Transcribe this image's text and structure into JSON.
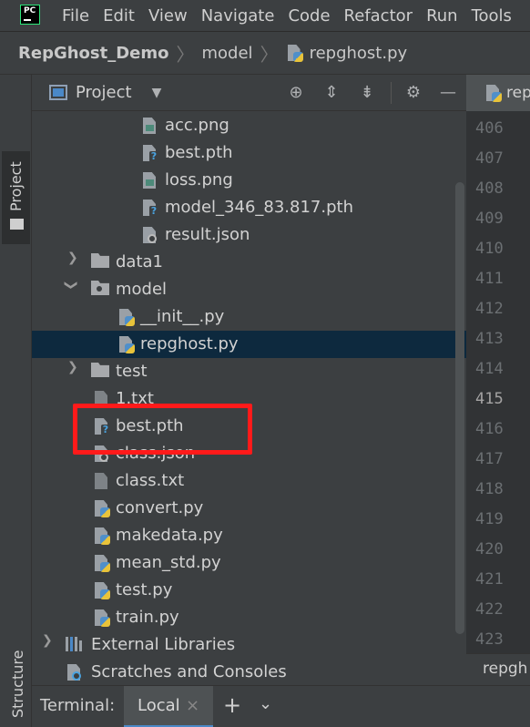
{
  "menu": {
    "app_icon_text": "PC",
    "items": [
      "File",
      "Edit",
      "View",
      "Navigate",
      "Code",
      "Refactor",
      "Run",
      "Tools"
    ]
  },
  "breadcrumb": {
    "root": "RepGhost_Demo",
    "folder": "model",
    "file": "repghost.py"
  },
  "left_strip": {
    "project_tab": "Project",
    "structure_tab": "Structure"
  },
  "project_panel": {
    "title": "Project",
    "dropdown_icon": "caret-down-icon",
    "header_icons": [
      "locate-icon",
      "expand-all-icon",
      "collapse-all-icon",
      "gear-icon",
      "minimize-icon"
    ]
  },
  "tree": {
    "rows": [
      {
        "label": "acc.png",
        "icon": "image-file-icon"
      },
      {
        "label": "best.pth",
        "icon": "unknown-file-icon"
      },
      {
        "label": "loss.png",
        "icon": "image-file-icon"
      },
      {
        "label": "model_346_83.817.pth",
        "icon": "unknown-file-icon"
      },
      {
        "label": "result.json",
        "icon": "json-file-icon"
      },
      {
        "label": "data1",
        "icon": "folder-icon",
        "expanded": false
      },
      {
        "label": "model",
        "icon": "module-folder-icon",
        "expanded": true
      },
      {
        "label": "__init__.py",
        "icon": "python-file-icon"
      },
      {
        "label": "repghost.py",
        "icon": "python-file-icon",
        "selected": true
      },
      {
        "label": "test",
        "icon": "folder-icon",
        "expanded": false
      },
      {
        "label": "1.txt",
        "icon": "text-file-icon"
      },
      {
        "label": "best.pth",
        "icon": "unknown-file-icon",
        "highlighted": true
      },
      {
        "label": "class.json",
        "icon": "json-file-icon"
      },
      {
        "label": "class.txt",
        "icon": "text-file-icon"
      },
      {
        "label": "convert.py",
        "icon": "python-file-icon"
      },
      {
        "label": "makedata.py",
        "icon": "python-file-icon"
      },
      {
        "label": "mean_std.py",
        "icon": "python-file-icon"
      },
      {
        "label": "test.py",
        "icon": "python-file-icon"
      },
      {
        "label": "train.py",
        "icon": "python-file-icon"
      },
      {
        "label": "External Libraries",
        "icon": "library-icon",
        "expanded": false
      },
      {
        "label": "Scratches and Consoles",
        "icon": "scratches-icon"
      }
    ]
  },
  "editor": {
    "tab_label": "repg",
    "line_numbers": [
      "406",
      "407",
      "408",
      "409",
      "410",
      "411",
      "412",
      "413",
      "414",
      "415",
      "416",
      "417",
      "418",
      "419",
      "420",
      "421",
      "422",
      "423"
    ],
    "current_line": "415",
    "bottom_label": "repgh"
  },
  "terminal": {
    "label": "Terminal:",
    "tab": "Local",
    "close_icon": "×",
    "add_icon": "+",
    "menu_icon": "⌄"
  },
  "colors": {
    "highlight_box": "#ff1a1a",
    "selection": "#0d293e",
    "panel_bg": "#3c3f41",
    "editor_bg": "#2b2b2b"
  }
}
